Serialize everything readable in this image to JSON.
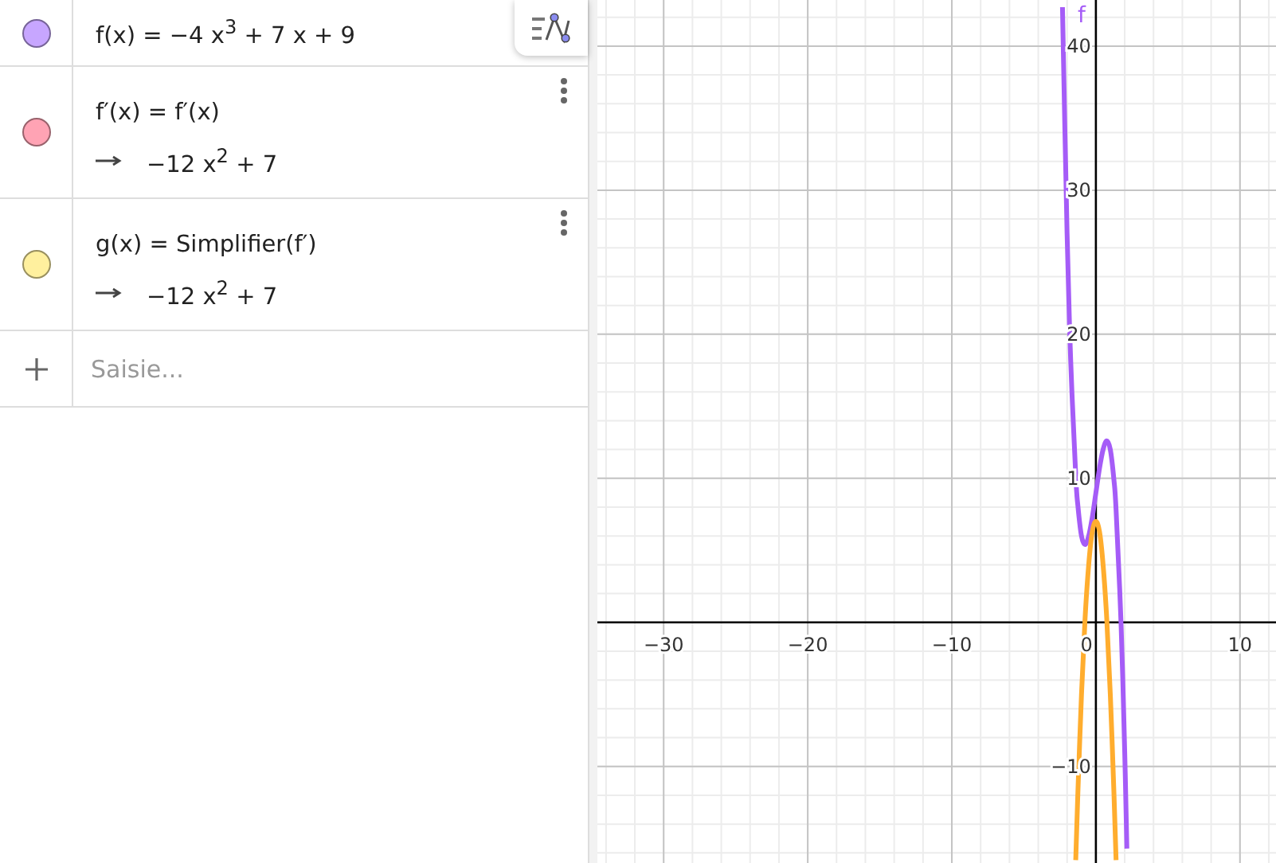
{
  "algebra_view": {
    "items": [
      {
        "kind": "function",
        "color": "#c7a6ff",
        "definition": "f(x) = −4 x$^{3}$ + 7 x + 9"
      },
      {
        "kind": "function",
        "color": "#ffa3b4",
        "definition": "f′(x) = f′(x)",
        "result": "−12 x$^{2}$ + 7"
      },
      {
        "kind": "function",
        "color": "#fff09e",
        "definition": "g(x) = Simplifier(f′)",
        "result": "−12 x$^{2}$ + 7"
      }
    ],
    "input": {
      "placeholder": "Saisie..."
    }
  },
  "graphics_view": {
    "chart_data": {
      "type": "line",
      "x": [
        -2.32,
        -2,
        -1.75,
        -1.4,
        -1.25,
        -1,
        -0.75,
        -0.5,
        -0.25,
        0,
        0.25,
        0.5,
        0.75,
        1,
        1.25,
        1.4,
        1.75,
        2,
        2.15
      ],
      "series": [
        {
          "name": "f",
          "color": "#a55cf7",
          "values": [
            42.7,
            27,
            18.2,
            10.2,
            8.1,
            6,
            5.4,
            6,
            7.3,
            9,
            10.7,
            12,
            12.6,
            12,
            9.9,
            7.8,
            -0.2,
            -9,
            -15.7
          ]
        },
        {
          "color": "#ffad2e",
          "values": [
            null,
            null,
            null,
            -16.5,
            -11.8,
            -5,
            0.3,
            4,
            6.3,
            7,
            6.3,
            4,
            0.3,
            -5,
            -11.8,
            -16.5,
            null,
            null,
            null
          ]
        }
      ],
      "grid": true,
      "xlim": [
        -34.6,
        12.5
      ],
      "ylim": [
        -16.7,
        43.2
      ],
      "xticks": [
        {
          "value": -30,
          "label": "−30"
        },
        {
          "value": -20,
          "label": "−20"
        },
        {
          "value": -10,
          "label": "−10"
        },
        {
          "value": 0,
          "label": "0"
        },
        {
          "value": 10,
          "label": "10"
        }
      ],
      "yticks": [
        {
          "value": -10,
          "label": "−10"
        },
        {
          "value": 10,
          "label": "10"
        },
        {
          "value": 20,
          "label": "20"
        },
        {
          "value": 30,
          "label": "30"
        },
        {
          "value": 40,
          "label": "40"
        }
      ]
    }
  }
}
